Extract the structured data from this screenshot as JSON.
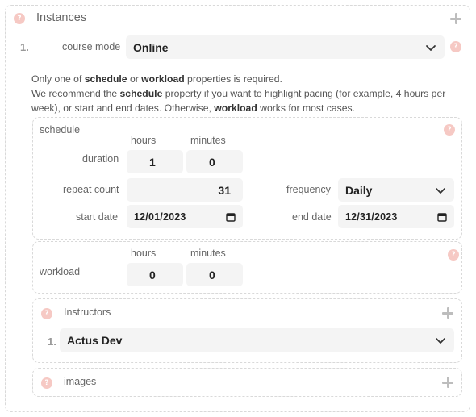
{
  "instances": {
    "title": "Instances",
    "index": "1.",
    "course_mode": {
      "label": "course mode",
      "value": "Online"
    },
    "note": {
      "t1": "Only one of ",
      "b1": "schedule",
      "t2": " or ",
      "b2": "workload",
      "t3": " properties is required.",
      "t4": "We recommend the ",
      "b3": "schedule",
      "t5": " property if you want to highlight pacing (for example, 4 hours per week), or start and end dates. Otherwise, ",
      "b4": "workload",
      "t6": " works for most cases."
    },
    "schedule": {
      "title": "schedule",
      "hours_label": "hours",
      "minutes_label": "minutes",
      "duration_label": "duration",
      "duration_hours": "1",
      "duration_minutes": "0",
      "repeat_count_label": "repeat count",
      "repeat_count": "31",
      "frequency_label": "frequency",
      "frequency": "Daily",
      "start_date_label": "start date",
      "start_date": "12/01/2023",
      "end_date_label": "end date",
      "end_date": "12/31/2023"
    },
    "workload": {
      "title": "workload",
      "hours_label": "hours",
      "minutes_label": "minutes",
      "hours": "0",
      "minutes": "0"
    },
    "instructors": {
      "title": "Instructors",
      "index": "1.",
      "value": "Actus Dev"
    },
    "images": {
      "title": "images"
    }
  },
  "colors": {
    "help_badge": "#f6c9c4",
    "field_bg": "#f4f4f4",
    "border": "#d9d9d9"
  }
}
